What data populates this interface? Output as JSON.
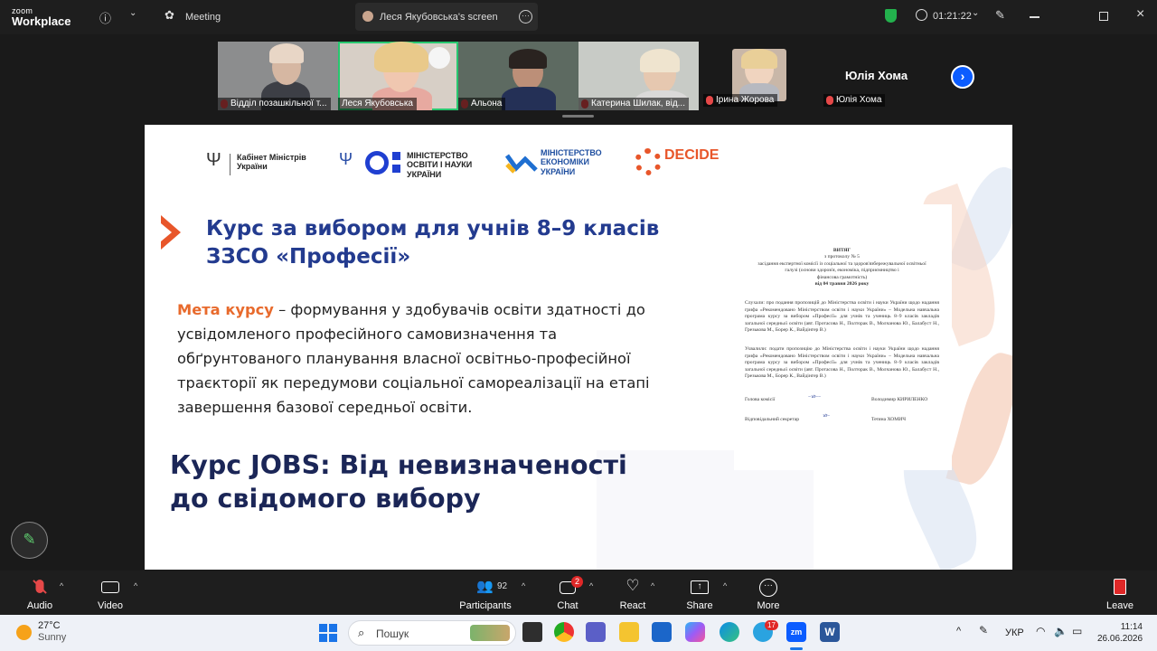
{
  "app": {
    "brand_top": "zoom",
    "brand_bottom": "Workplace",
    "meeting_label": "Meeting",
    "screen_label": "Леся Якубовська's screen",
    "timer": "01:21:22"
  },
  "participants": [
    {
      "name": "Відділ позашкільної т..."
    },
    {
      "name": "Леся Якубовська"
    },
    {
      "name": "Альона"
    },
    {
      "name": "Катерина Шилак, від..."
    },
    {
      "name": "Ірина Жорова"
    },
    {
      "name": "Юлія Хома"
    }
  ],
  "featured_name": "Юлія Хома",
  "slide": {
    "logos": {
      "cabinet": "Кабінет Міністрів України",
      "mon_l1": "МІНІСТЕРСТВО",
      "mon_l2": "ОСВІТИ І НАУКИ",
      "mon_l3": "УКРАЇНИ",
      "econ_l1": "МІНІСТЕРСТВО",
      "econ_l2": "ЕКОНОМІКИ",
      "econ_l3": "УКРАЇНИ",
      "decide": "DECIDE"
    },
    "heading_l1": "Курс за вибором для учнів 8–9 класів",
    "heading_l2": "ЗЗСО «Професії»",
    "goal_accent": "Мета курсу",
    "goal_l1": " – формування у здобувачів освіти здатності до",
    "goal_l2": "усвідомленого професійного самовизначення та",
    "goal_l3": "обґрунтованого планування власної  освітньо-професійної",
    "goal_l4": "траєкторії як передумови соціальної самореалізації на етапі",
    "goal_l5": "завершення базової середньої освіти.",
    "jobs_l1": "Курс JOBS: Від невизначеності",
    "jobs_l2": "до свідомого вибору",
    "doc": {
      "title": "ВИТЯГ",
      "protocol": "з протоколу № 5",
      "l1": "засідання експертної комісії із соціальної та здоров'язбережувальної освітньої",
      "l2": "галузі (основи здоров'я, економіка, підприємництво і",
      "l3": "фінансова грамотність)",
      "l4": "від 04 травня 2026 року",
      "heard": "Слухали: про подання пропозицій до Міністерства освіти і науки України щодо надання грифа «Рекомендовано Міністерством освіти і науки України» – Модельна навчальна програма курсу за вибором «Професії» для учнів та учениць 8–9 класів закладів загальної середньої освіти (авт. Протасова Н., Полторак В., Молчанова Ю., Балабуст Н., Грезькова М., Борер К., Вайдінгер В.)",
      "decided": "Ухвалили: подати пропозицію до Міністерства освіти і науки України щодо надання грифа «Рекомендовано Міністерством освіти і науки України» – Модельна навчальна програма курсу за вибором «Професії» для учнів та учениць 8–9 класів закладів загальної середньої освіти (авт. Протасова Н., Полторак В., Молчанова Ю., Балабуст Н., Грезькова М., Борер К., Вайдінгер В.)",
      "head_role": "Голова комісії",
      "head_name": "Володимир  КИРИЛЕНКО",
      "sec_role": "Відповідальний секретар",
      "sec_name": "Тетяна  ХОМИЧ"
    }
  },
  "toolbar": {
    "audio": "Audio",
    "video": "Video",
    "participants": "Participants",
    "participants_count": "92",
    "chat": "Chat",
    "chat_badge": "2",
    "react": "React",
    "share": "Share",
    "more": "More",
    "leave": "Leave"
  },
  "taskbar": {
    "temp": "27°C",
    "weather": "Sunny",
    "search": "Пошук",
    "lang": "УКР",
    "time": "11:14",
    "date": "26.06.2026",
    "telegram_badge": "17"
  },
  "colors": {
    "accent_orange": "#e86a2c",
    "heading_blue": "#233b8f",
    "zoom_blue": "#0b5cff",
    "leave_red": "#e02828"
  }
}
